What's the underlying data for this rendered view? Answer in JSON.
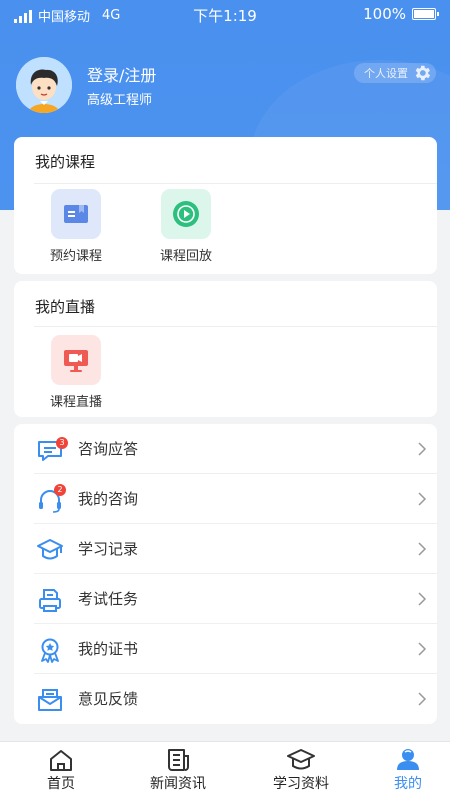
{
  "status_bar": {
    "carrier": "中国移动",
    "network": "4G",
    "time": "下午1:19",
    "battery": "100%"
  },
  "profile": {
    "name": "登录/注册",
    "title": "高级工程师",
    "settings_label": "个人设置"
  },
  "courses": {
    "title": "我的课程",
    "items": [
      {
        "label": "预约课程",
        "icon": "book-icon",
        "color": "#5b87e6"
      },
      {
        "label": "课程回放",
        "icon": "play-icon",
        "color": "#2cbf7e"
      }
    ]
  },
  "live": {
    "title": "我的直播",
    "items": [
      {
        "label": "课程直播",
        "icon": "live-camera-icon",
        "color": "#ef5a55"
      }
    ]
  },
  "menu": [
    {
      "label": "咨询应答",
      "icon": "message-icon",
      "badge": "3"
    },
    {
      "label": "我的咨询",
      "icon": "headset-icon",
      "badge": "2"
    },
    {
      "label": "学习记录",
      "icon": "graduation-cap-icon"
    },
    {
      "label": "考试任务",
      "icon": "printer-icon"
    },
    {
      "label": "我的证书",
      "icon": "certificate-icon"
    },
    {
      "label": "意见反馈",
      "icon": "mail-icon"
    }
  ],
  "tabbar": {
    "items": [
      {
        "label": "首页",
        "icon": "home-icon"
      },
      {
        "label": "新闻资讯",
        "icon": "news-icon"
      },
      {
        "label": "学习资料",
        "icon": "graduation-cap-icon"
      },
      {
        "label": "我的",
        "icon": "user-icon",
        "active": true
      }
    ]
  },
  "colors": {
    "primary": "#4a90ee",
    "accent": "#3a8ef0",
    "badge": "#f04438"
  }
}
